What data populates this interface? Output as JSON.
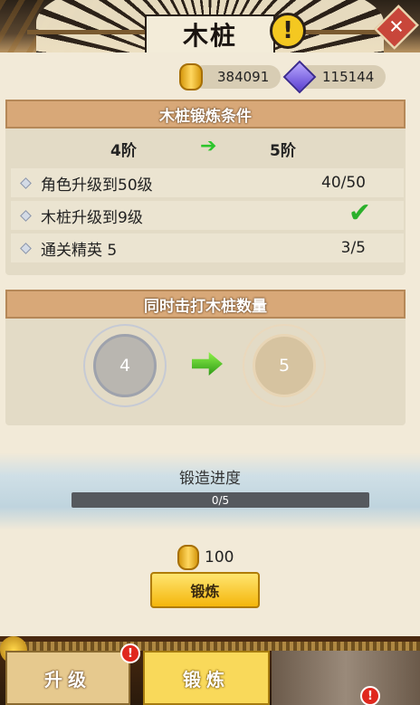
{
  "header": {
    "title": "木桩",
    "alert_glyph": "!",
    "close_glyph": "✕"
  },
  "currency": {
    "gold": "384091",
    "gems": "115144"
  },
  "conditions_section": {
    "title": "木桩锻炼条件",
    "from_tier": "4阶",
    "to_tier": "5阶",
    "rows": [
      {
        "label": "角色升级到50级",
        "value": "40/50",
        "done": false
      },
      {
        "label": "木桩升级到9级",
        "value": "",
        "done": true
      },
      {
        "label": "通关精英 5",
        "value": "3/5",
        "done": false
      }
    ]
  },
  "stake_count_section": {
    "title": "同时击打木桩数量",
    "current": "4",
    "next": "5"
  },
  "progress": {
    "title": "锻造进度",
    "text": "0/5",
    "fraction": 0
  },
  "cost": {
    "amount": "100"
  },
  "forge_button": {
    "label": "锻炼"
  },
  "bottom_tabs": [
    {
      "label": "升级",
      "active": false,
      "badge": "!"
    },
    {
      "label": "锻炼",
      "active": true,
      "badge": "!"
    }
  ],
  "colors": {
    "accent_gold": "#f4b60c",
    "header_tan": "#d8a878",
    "check_green": "#2bb02b",
    "badge_red": "#e0281e"
  }
}
